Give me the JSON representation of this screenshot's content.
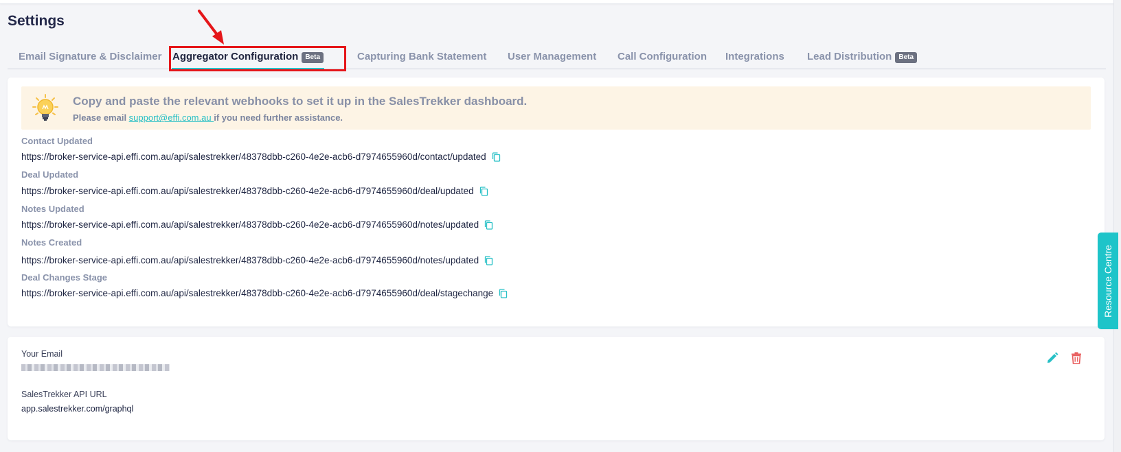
{
  "page": {
    "title": "Settings"
  },
  "tabs": [
    {
      "label": "Email Signature & Disclaimer",
      "badge": ""
    },
    {
      "label": "Aggregator Configuration",
      "badge": "Beta"
    },
    {
      "label": "Capturing Bank Statement",
      "badge": ""
    },
    {
      "label": "User Management",
      "badge": ""
    },
    {
      "label": "Call Configuration",
      "badge": ""
    },
    {
      "label": "Integrations",
      "badge": ""
    },
    {
      "label": "Lead Distribution",
      "badge": "Beta"
    }
  ],
  "active_tab": "Aggregator Configuration",
  "info": {
    "title": "Copy and paste the relevant webhooks to set it up in the SalesTrekker dashboard.",
    "sub_prefix": "Please email ",
    "email": "support@effi.com.au ",
    "sub_suffix": "if you need further assistance."
  },
  "webhooks": [
    {
      "label": "Contact Updated",
      "url": "https://broker-service-api.effi.com.au/api/salestrekker/48378dbb-c260-4e2e-acb6-d7974655960d/contact/updated"
    },
    {
      "label": "Deal Updated",
      "url": "https://broker-service-api.effi.com.au/api/salestrekker/48378dbb-c260-4e2e-acb6-d7974655960d/deal/updated"
    },
    {
      "label": "Notes Updated",
      "url": "https://broker-service-api.effi.com.au/api/salestrekker/48378dbb-c260-4e2e-acb6-d7974655960d/notes/updated"
    },
    {
      "label": "Notes Created",
      "url": "https://broker-service-api.effi.com.au/api/salestrekker/48378dbb-c260-4e2e-acb6-d7974655960d/notes/updated"
    },
    {
      "label": "Deal Changes Stage",
      "url": "https://broker-service-api.effi.com.au/api/salestrekker/48378dbb-c260-4e2e-acb6-d7974655960d/deal/stagechange"
    }
  ],
  "account": {
    "email_label": "Your Email",
    "api_url_label": "SalesTrekker API URL",
    "api_url": "app.salestrekker.com/graphql"
  },
  "resource_centre": "Resource Centre",
  "colors": {
    "accent": "#27c0c6",
    "highlight": "#e5161a",
    "delete": "#e85a5a",
    "tip_background": "#fdf4e5"
  },
  "icons": [
    "lightbulb-icon",
    "copy-icon",
    "pencil-icon",
    "trash-icon",
    "arrow-annotation"
  ]
}
